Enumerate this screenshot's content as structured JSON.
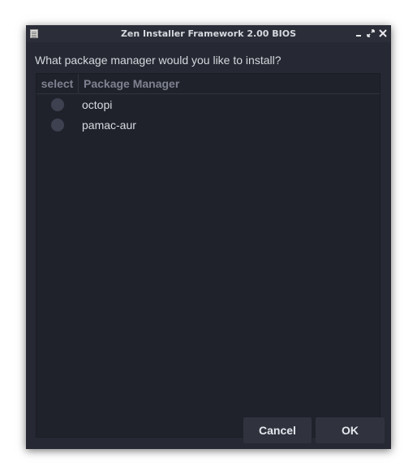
{
  "window": {
    "title": "Zen Installer Framework 2.00 BIOS",
    "controls": [
      "minimize-icon",
      "maximize-icon",
      "close-icon"
    ]
  },
  "dialog": {
    "prompt": "What package manager would you like to install?"
  },
  "list": {
    "columns": [
      "select",
      "Package Manager"
    ],
    "rows": [
      {
        "selected": false,
        "label": "octopi"
      },
      {
        "selected": false,
        "label": "pamac-aur"
      }
    ]
  },
  "buttons": {
    "cancel": "Cancel",
    "ok": "OK"
  },
  "colors": {
    "window_bg": "#262833",
    "list_bg": "#20222b",
    "button_bg": "#30323e",
    "radio": "#3e4150"
  }
}
